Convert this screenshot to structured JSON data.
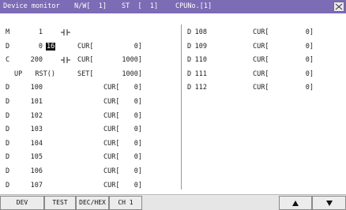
{
  "title_bar": {
    "title": "Device monitor",
    "network": "N/W[  1]",
    "station": "ST  [  1]",
    "cpu": "CPUNo.[1]"
  },
  "left_rows": [
    {
      "dev": "M",
      "num": "1",
      "contact": true
    },
    {
      "dev": "D",
      "num": "0",
      "fmt": "16",
      "cur_label": "CUR[",
      "cur_val": "0]"
    },
    {
      "dev": "C",
      "num": "200",
      "contact": true,
      "cur_label": "CUR[",
      "cur_val": "1000]"
    },
    {
      "dev": "UP",
      "num": "RST()",
      "cur_label": "SET[",
      "cur_val": "1000]"
    },
    {
      "dev": "D",
      "num": "100",
      "cur_label": "CUR[",
      "cur_val": "0]"
    },
    {
      "dev": "D",
      "num": "101",
      "cur_label": "CUR[",
      "cur_val": "0]"
    },
    {
      "dev": "D",
      "num": "102",
      "cur_label": "CUR[",
      "cur_val": "0]"
    },
    {
      "dev": "D",
      "num": "103",
      "cur_label": "CUR[",
      "cur_val": "0]"
    },
    {
      "dev": "D",
      "num": "104",
      "cur_label": "CUR[",
      "cur_val": "0]"
    },
    {
      "dev": "D",
      "num": "105",
      "cur_label": "CUR[",
      "cur_val": "0]"
    },
    {
      "dev": "D",
      "num": "106",
      "cur_label": "CUR[",
      "cur_val": "0]"
    },
    {
      "dev": "D",
      "num": "107",
      "cur_label": "CUR[",
      "cur_val": "0]"
    }
  ],
  "right_rows": [
    {
      "dev": "D",
      "num": "108",
      "cur_label": "CUR[",
      "cur_val": "0]"
    },
    {
      "dev": "D",
      "num": "109",
      "cur_label": "CUR[",
      "cur_val": "0]"
    },
    {
      "dev": "D",
      "num": "110",
      "cur_label": "CUR[",
      "cur_val": "0]"
    },
    {
      "dev": "D",
      "num": "111",
      "cur_label": "CUR[",
      "cur_val": "0]"
    },
    {
      "dev": "D",
      "num": "112",
      "cur_label": "CUR[",
      "cur_val": "0]"
    }
  ],
  "buttons": {
    "dev": "DEV",
    "test": "TEST",
    "dechex": "DEC/HEX",
    "ch": "CH 1"
  },
  "icons": {
    "close": "close-x-icon",
    "contact": "ladder-contact-icon",
    "up": "up-triangle-icon",
    "down": "down-triangle-icon"
  },
  "colors": {
    "title_bar": "#7c6bb5",
    "background": "#ffffff",
    "button_face": "#ececec"
  }
}
